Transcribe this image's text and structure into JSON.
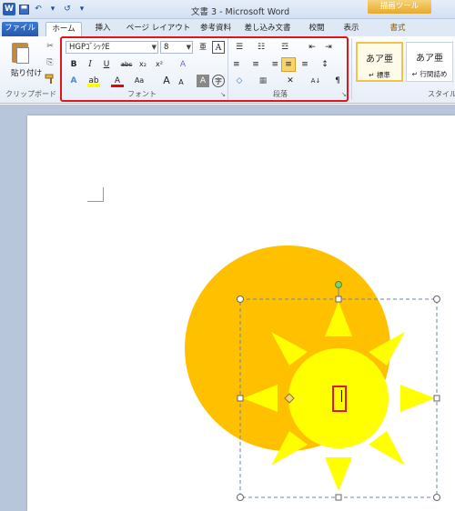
{
  "title_bar": {
    "title": "文書 3 - Microsoft Word",
    "context_tab": "描画ツール",
    "qat": {
      "logo": "W",
      "undo": "↶",
      "redo": "↺",
      "customize": "▾"
    }
  },
  "tabs": [
    {
      "label": "ファイル"
    },
    {
      "label": "ホーム"
    },
    {
      "label": "挿入"
    },
    {
      "label": "ページ レイアウト"
    },
    {
      "label": "参考資料"
    },
    {
      "label": "差し込み文書"
    },
    {
      "label": "校閲"
    },
    {
      "label": "表示"
    },
    {
      "label": "書式"
    }
  ],
  "ribbon": {
    "clipboard": {
      "paste_label": "貼り付け",
      "group_label": "クリップボード",
      "cut": "✂",
      "copy": "⎘",
      "format_painter": "🖌"
    },
    "font": {
      "font_name": "HGPｺﾞｼｯｸE",
      "font_size": "8",
      "group_label": "フォント",
      "bold": "B",
      "italic": "I",
      "underline": "U",
      "strike": "abc",
      "subscript": "x₂",
      "superscript": "x²",
      "clear": "A",
      "grow": "A",
      "shrink": "A",
      "case": "Aa",
      "text_effects": "A",
      "highlight": "ab",
      "font_color": "A",
      "char_shading": "A",
      "enclose": "字",
      "phonetic": "亜",
      "char_border": "A"
    },
    "paragraph": {
      "group_label": "段落",
      "bullets": "☰",
      "numbering": "☷",
      "multilevel": "☲",
      "decrease_indent": "⇤",
      "increase_indent": "⇥",
      "align_left": "≡",
      "center": "≡",
      "align_right": "≡",
      "justify": "≡",
      "distribute": "≡",
      "line_spacing": "↕",
      "shading": "◇",
      "borders": "▦",
      "asian_layout": "✕",
      "sort": "A↓",
      "show_marks": "¶"
    },
    "styles": {
      "group_label": "スタイル",
      "items": [
        {
          "preview": "あア亜",
          "name": "↵ 標準"
        },
        {
          "preview": "あア亜",
          "name": "↵ 行間詰め"
        }
      ]
    }
  },
  "document": {
    "cursor_glyph": "|"
  },
  "colors": {
    "sun_disc": "#FFC000",
    "sun_shape": "#FFFF00",
    "highlight_border": "#E0151D"
  }
}
